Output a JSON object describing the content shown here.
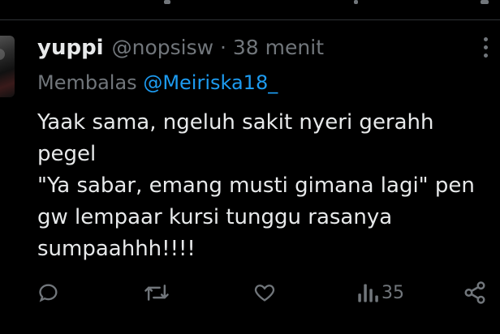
{
  "tweet": {
    "name": "yuppi",
    "handle": "@nopsisw",
    "separator": "·",
    "time": "38 menit",
    "reply_prefix": "Membalas",
    "reply_to": "@Meiriska18_",
    "text": "Yaak sama, ngeluh sakit nyeri gerahh\npegel\n\"Ya sabar, emang musti gimana lagi\" pen\ngw lempaar kursi tunggu rasanya\nsumpaahhh!!!!"
  },
  "actions": {
    "reply_icon": "comment-icon",
    "retweet_icon": "retweet-icon",
    "like_icon": "heart-icon",
    "views_icon": "views-icon",
    "views_count": "35",
    "share_icon": "share-icon"
  },
  "colors": {
    "background": "#000000",
    "text": "#e7e9ea",
    "muted": "#71767b",
    "link": "#1d9bf0"
  }
}
